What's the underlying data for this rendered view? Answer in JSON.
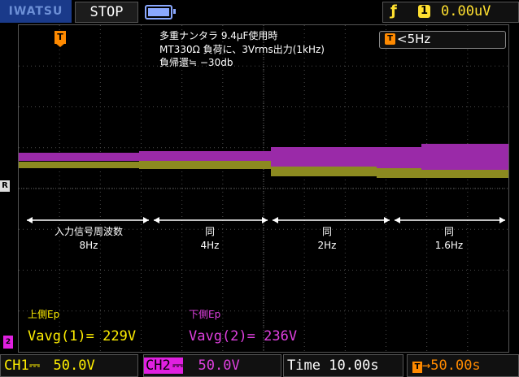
{
  "header": {
    "brand": "IWATSU",
    "run_state": "STOP",
    "trigger_channel": "1",
    "trigger_level": "0.00uV",
    "trigger_edge_icon": "rising-edge-icon"
  },
  "overlay": {
    "trigger_marker": "T",
    "ref_marker": "R",
    "ch2_marker": "2",
    "trigger_freq_icon": "T",
    "trigger_freq": "<5Hz"
  },
  "notes": {
    "line1": "多重ナンタラ 9.4μF使用時",
    "line2": "MT330Ω 負荷に、3Vrms出力(1kHz)",
    "line3": "負帰還≒ −30db"
  },
  "segments": [
    {
      "label1": "入力信号周波数",
      "label2": "8Hz"
    },
    {
      "label1": "同",
      "label2": "4Hz"
    },
    {
      "label1": "同",
      "label2": "2Hz"
    },
    {
      "label1": "同",
      "label2": "1.6Hz"
    }
  ],
  "measurements": {
    "ch1_title": "上側Ep",
    "ch1_value": "Vavg(1)= 229V",
    "ch2_title": "下側Ep",
    "ch2_value": "Vavg(2)= 236V"
  },
  "footer": {
    "ch1": "CH1",
    "ch1_coupling": "⎓",
    "ch1_scale": "50.0V",
    "ch2": "CH2",
    "ch2_coupling": "⎓",
    "ch2_scale": "50.0V",
    "time_label": "Time",
    "time_scale": "10.00s",
    "delay": "50.00s"
  },
  "colors": {
    "ch1": "#8c8a20",
    "ch2": "#9a2aa8",
    "ch1_text": "#ffee00",
    "ch2_text": "#e040e0",
    "trigger": "#ff8a00"
  }
}
